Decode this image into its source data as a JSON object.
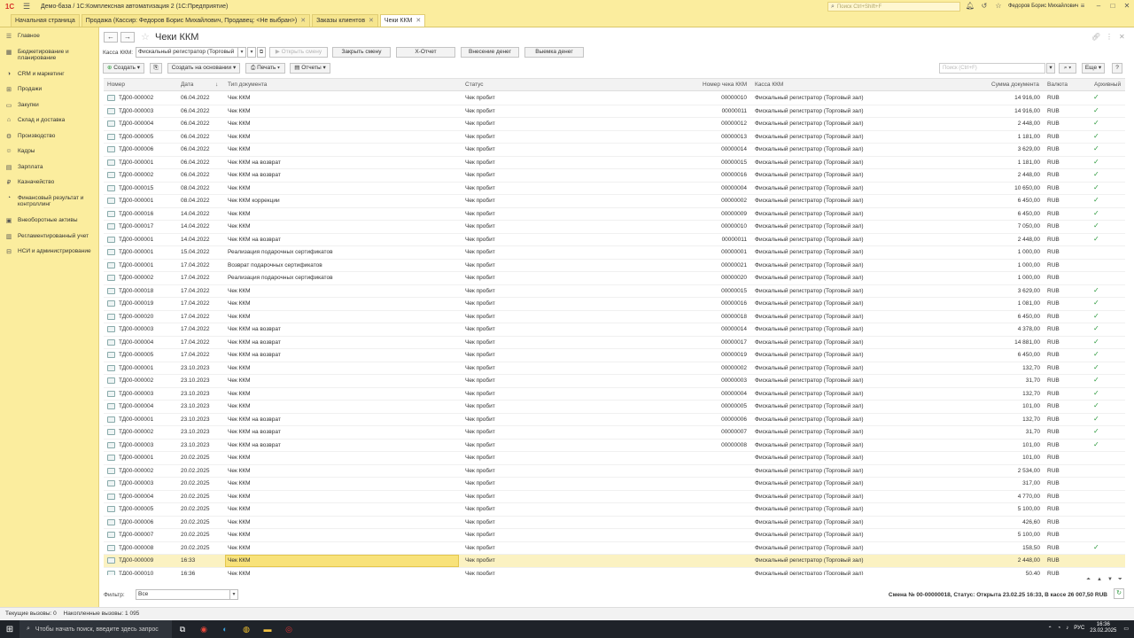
{
  "app": {
    "logo": "1С",
    "title": "Демо-база / 1С:Комплексная автоматизация 2  (1С:Предприятие)",
    "search_placeholder": "Поиск Ctrl+Shift+F",
    "user": "Федоров Борис Михайлович"
  },
  "tabs": [
    {
      "label": "Начальная страница",
      "closable": false,
      "active": false
    },
    {
      "label": "Продажа (Кассир: Федоров Борис Михайлович, Продавец: <Не выбран>)",
      "closable": true,
      "active": false
    },
    {
      "label": "Заказы клиентов",
      "closable": true,
      "active": false
    },
    {
      "label": "Чеки ККМ",
      "closable": true,
      "active": true
    }
  ],
  "sidebar": {
    "items": [
      {
        "icon": "menu-icon",
        "label": "Главное"
      },
      {
        "icon": "budget-icon",
        "label": "Бюджетирование и планирование"
      },
      {
        "icon": "crm-icon",
        "label": "CRM и маркетинг"
      },
      {
        "icon": "sales-icon",
        "label": "Продажи"
      },
      {
        "icon": "purchase-icon",
        "label": "Закупки"
      },
      {
        "icon": "warehouse-icon",
        "label": "Склад и доставка"
      },
      {
        "icon": "production-icon",
        "label": "Производство"
      },
      {
        "icon": "staff-icon",
        "label": "Кадры"
      },
      {
        "icon": "salary-icon",
        "label": "Зарплата"
      },
      {
        "icon": "treasury-icon",
        "label": "Казначейство"
      },
      {
        "icon": "finance-icon",
        "label": "Финансовый результат и контроллинг"
      },
      {
        "icon": "assets-icon",
        "label": "Внеоборотные активы"
      },
      {
        "icon": "report-icon",
        "label": "Регламентированный учет"
      },
      {
        "icon": "nsi-icon",
        "label": "НСИ и администрирование"
      }
    ]
  },
  "page": {
    "title": "Чеки ККМ",
    "kkm_label": "Касса ККМ:",
    "kkm_value": "Фискальный регистратор (Торговый",
    "buttons": {
      "open_shift": "Открыть смену",
      "close_shift": "Закрыть смену",
      "x_report": "Х-Отчет",
      "cash_in": "Внесение денег",
      "cash_out": "Выемка денег"
    },
    "toolbar": {
      "create": "Создать",
      "create_based": "Создать на основании",
      "print": "Печать",
      "reports": "Отчеты",
      "search_placeholder": "Поиск (Ctrl+F)",
      "more": "Еще",
      "help": "?"
    }
  },
  "table": {
    "columns": [
      "Номер",
      "Дата",
      "Тип документа",
      "Статус",
      "Номер чека ККМ",
      "Касса ККМ",
      "Сумма документа",
      "Валюта",
      "Архивный"
    ],
    "rows": [
      {
        "num": "ТД00-000002",
        "date": "06.04.2022",
        "type": "Чек ККМ",
        "status": "Чек пробит",
        "check": "00000010",
        "kkm": "Фискальный регистратор (Торговый зал)",
        "sum": "14 916,00",
        "cur": "RUB",
        "arch": true
      },
      {
        "num": "ТД00-000003",
        "date": "06.04.2022",
        "type": "Чек ККМ",
        "status": "Чек пробит",
        "check": "00000011",
        "kkm": "Фискальный регистратор (Торговый зал)",
        "sum": "14 916,00",
        "cur": "RUB",
        "arch": true
      },
      {
        "num": "ТД00-000004",
        "date": "06.04.2022",
        "type": "Чек ККМ",
        "status": "Чек пробит",
        "check": "00000012",
        "kkm": "Фискальный регистратор (Торговый зал)",
        "sum": "2 448,00",
        "cur": "RUB",
        "arch": true
      },
      {
        "num": "ТД00-000005",
        "date": "06.04.2022",
        "type": "Чек ККМ",
        "status": "Чек пробит",
        "check": "00000013",
        "kkm": "Фискальный регистратор (Торговый зал)",
        "sum": "1 181,00",
        "cur": "RUB",
        "arch": true
      },
      {
        "num": "ТД00-000006",
        "date": "06.04.2022",
        "type": "Чек ККМ",
        "status": "Чек пробит",
        "check": "00000014",
        "kkm": "Фискальный регистратор (Торговый зал)",
        "sum": "3 629,00",
        "cur": "RUB",
        "arch": true
      },
      {
        "num": "ТД00-000001",
        "date": "06.04.2022",
        "type": "Чек ККМ на возврат",
        "status": "Чек пробит",
        "check": "00000015",
        "kkm": "Фискальный регистратор (Торговый зал)",
        "sum": "1 181,00",
        "cur": "RUB",
        "arch": true
      },
      {
        "num": "ТД00-000002",
        "date": "06.04.2022",
        "type": "Чек ККМ на возврат",
        "status": "Чек пробит",
        "check": "00000016",
        "kkm": "Фискальный регистратор (Торговый зал)",
        "sum": "2 448,00",
        "cur": "RUB",
        "arch": true
      },
      {
        "num": "ТД00-000015",
        "date": "08.04.2022",
        "type": "Чек ККМ",
        "status": "Чек пробит",
        "check": "00000004",
        "kkm": "Фискальный регистратор (Торговый зал)",
        "sum": "10 650,00",
        "cur": "RUB",
        "arch": true
      },
      {
        "num": "ТД00-000001",
        "date": "08.04.2022",
        "type": "Чек ККМ коррекции",
        "status": "Чек пробит",
        "check": "00000002",
        "kkm": "Фискальный регистратор (Торговый зал)",
        "sum": "6 450,00",
        "cur": "RUB",
        "arch": true
      },
      {
        "num": "ТД00-000016",
        "date": "14.04.2022",
        "type": "Чек ККМ",
        "status": "Чек пробит",
        "check": "00000009",
        "kkm": "Фискальный регистратор (Торговый зал)",
        "sum": "6 450,00",
        "cur": "RUB",
        "arch": true
      },
      {
        "num": "ТД00-000017",
        "date": "14.04.2022",
        "type": "Чек ККМ",
        "status": "Чек пробит",
        "check": "00000010",
        "kkm": "Фискальный регистратор (Торговый зал)",
        "sum": "7 050,00",
        "cur": "RUB",
        "arch": true
      },
      {
        "num": "ТД00-000001",
        "date": "14.04.2022",
        "type": "Чек ККМ на возврат",
        "status": "Чек пробит",
        "check": "00000011",
        "kkm": "Фискальный регистратор (Торговый зал)",
        "sum": "2 448,00",
        "cur": "RUB",
        "arch": true
      },
      {
        "num": "ТД00-000001",
        "date": "15.04.2022",
        "type": "Реализация подарочных сертификатов",
        "status": "Чек пробит",
        "check": "00000001",
        "kkm": "Фискальный регистратор (Торговый зал)",
        "sum": "1 000,00",
        "cur": "RUB",
        "arch": false
      },
      {
        "num": "ТД00-000001",
        "date": "17.04.2022",
        "type": "Возврат подарочных сертификатов",
        "status": "Чек пробит",
        "check": "00000021",
        "kkm": "Фискальный регистратор (Торговый зал)",
        "sum": "1 000,00",
        "cur": "RUB",
        "arch": false
      },
      {
        "num": "ТД00-000002",
        "date": "17.04.2022",
        "type": "Реализация подарочных сертификатов",
        "status": "Чек пробит",
        "check": "00000020",
        "kkm": "Фискальный регистратор (Торговый зал)",
        "sum": "1 000,00",
        "cur": "RUB",
        "arch": false
      },
      {
        "num": "ТД00-000018",
        "date": "17.04.2022",
        "type": "Чек ККМ",
        "status": "Чек пробит",
        "check": "00000015",
        "kkm": "Фискальный регистратор (Торговый зал)",
        "sum": "3 629,00",
        "cur": "RUB",
        "arch": true
      },
      {
        "num": "ТД00-000019",
        "date": "17.04.2022",
        "type": "Чек ККМ",
        "status": "Чек пробит",
        "check": "00000016",
        "kkm": "Фискальный регистратор (Торговый зал)",
        "sum": "1 081,00",
        "cur": "RUB",
        "arch": true
      },
      {
        "num": "ТД00-000020",
        "date": "17.04.2022",
        "type": "Чек ККМ",
        "status": "Чек пробит",
        "check": "00000018",
        "kkm": "Фискальный регистратор (Торговый зал)",
        "sum": "6 450,00",
        "cur": "RUB",
        "arch": true
      },
      {
        "num": "ТД00-000003",
        "date": "17.04.2022",
        "type": "Чек ККМ на возврат",
        "status": "Чек пробит",
        "check": "00000014",
        "kkm": "Фискальный регистратор (Торговый зал)",
        "sum": "4 378,00",
        "cur": "RUB",
        "arch": true
      },
      {
        "num": "ТД00-000004",
        "date": "17.04.2022",
        "type": "Чек ККМ на возврат",
        "status": "Чек пробит",
        "check": "00000017",
        "kkm": "Фискальный регистратор (Торговый зал)",
        "sum": "14 881,00",
        "cur": "RUB",
        "arch": true
      },
      {
        "num": "ТД00-000005",
        "date": "17.04.2022",
        "type": "Чек ККМ на возврат",
        "status": "Чек пробит",
        "check": "00000019",
        "kkm": "Фискальный регистратор (Торговый зал)",
        "sum": "6 450,00",
        "cur": "RUB",
        "arch": true
      },
      {
        "num": "ТД00-000001",
        "date": "23.10.2023",
        "type": "Чек ККМ",
        "status": "Чек пробит",
        "check": "00000002",
        "kkm": "Фискальный регистратор (Торговый зал)",
        "sum": "132,70",
        "cur": "RUB",
        "arch": true
      },
      {
        "num": "ТД00-000002",
        "date": "23.10.2023",
        "type": "Чек ККМ",
        "status": "Чек пробит",
        "check": "00000003",
        "kkm": "Фискальный регистратор (Торговый зал)",
        "sum": "31,70",
        "cur": "RUB",
        "arch": true
      },
      {
        "num": "ТД00-000003",
        "date": "23.10.2023",
        "type": "Чек ККМ",
        "status": "Чек пробит",
        "check": "00000004",
        "kkm": "Фискальный регистратор (Торговый зал)",
        "sum": "132,70",
        "cur": "RUB",
        "arch": true
      },
      {
        "num": "ТД00-000004",
        "date": "23.10.2023",
        "type": "Чек ККМ",
        "status": "Чек пробит",
        "check": "00000005",
        "kkm": "Фискальный регистратор (Торговый зал)",
        "sum": "101,00",
        "cur": "RUB",
        "arch": true
      },
      {
        "num": "ТД00-000001",
        "date": "23.10.2023",
        "type": "Чек ККМ на возврат",
        "status": "Чек пробит",
        "check": "00000006",
        "kkm": "Фискальный регистратор (Торговый зал)",
        "sum": "132,70",
        "cur": "RUB",
        "arch": true
      },
      {
        "num": "ТД00-000002",
        "date": "23.10.2023",
        "type": "Чек ККМ на возврат",
        "status": "Чек пробит",
        "check": "00000007",
        "kkm": "Фискальный регистратор (Торговый зал)",
        "sum": "31,70",
        "cur": "RUB",
        "arch": true
      },
      {
        "num": "ТД00-000003",
        "date": "23.10.2023",
        "type": "Чек ККМ на возврат",
        "status": "Чек пробит",
        "check": "00000008",
        "kkm": "Фискальный регистратор (Торговый зал)",
        "sum": "101,00",
        "cur": "RUB",
        "arch": true
      },
      {
        "num": "ТД00-000001",
        "date": "20.02.2025",
        "type": "Чек ККМ",
        "status": "Чек пробит",
        "check": "",
        "kkm": "Фискальный регистратор (Торговый зал)",
        "sum": "101,00",
        "cur": "RUB",
        "arch": false
      },
      {
        "num": "ТД00-000002",
        "date": "20.02.2025",
        "type": "Чек ККМ",
        "status": "Чек пробит",
        "check": "",
        "kkm": "Фискальный регистратор (Торговый зал)",
        "sum": "2 534,00",
        "cur": "RUB",
        "arch": false
      },
      {
        "num": "ТД00-000003",
        "date": "20.02.2025",
        "type": "Чек ККМ",
        "status": "Чек пробит",
        "check": "",
        "kkm": "Фискальный регистратор (Торговый зал)",
        "sum": "317,00",
        "cur": "RUB",
        "arch": false
      },
      {
        "num": "ТД00-000004",
        "date": "20.02.2025",
        "type": "Чек ККМ",
        "status": "Чек пробит",
        "check": "",
        "kkm": "Фискальный регистратор (Торговый зал)",
        "sum": "4 770,00",
        "cur": "RUB",
        "arch": false
      },
      {
        "num": "ТД00-000005",
        "date": "20.02.2025",
        "type": "Чек ККМ",
        "status": "Чек пробит",
        "check": "",
        "kkm": "Фискальный регистратор (Торговый зал)",
        "sum": "5 100,00",
        "cur": "RUB",
        "arch": false
      },
      {
        "num": "ТД00-000006",
        "date": "20.02.2025",
        "type": "Чек ККМ",
        "status": "Чек пробит",
        "check": "",
        "kkm": "Фискальный регистратор (Торговый зал)",
        "sum": "426,60",
        "cur": "RUB",
        "arch": false
      },
      {
        "num": "ТД00-000007",
        "date": "20.02.2025",
        "type": "Чек ККМ",
        "status": "Чек пробит",
        "check": "",
        "kkm": "Фискальный регистратор (Торговый зал)",
        "sum": "5 100,00",
        "cur": "RUB",
        "arch": false
      },
      {
        "num": "ТД00-000008",
        "date": "20.02.2025",
        "type": "Чек ККМ",
        "status": "Чек пробит",
        "check": "",
        "kkm": "Фискальный регистратор (Торговый зал)",
        "sum": "158,50",
        "cur": "RUB",
        "arch": true
      },
      {
        "num": "ТД00-000009",
        "date": "16:33",
        "type": "Чек ККМ",
        "status": "Чек пробит",
        "check": "",
        "kkm": "Фискальный регистратор (Торговый зал)",
        "sum": "2 448,00",
        "cur": "RUB",
        "arch": false,
        "selected": true
      },
      {
        "num": "ТД00-000010",
        "date": "16:36",
        "type": "Чек ККМ",
        "status": "Чек пробит",
        "check": "",
        "kkm": "Фискальный регистратор (Торговый зал)",
        "sum": "50,40",
        "cur": "RUB",
        "arch": false
      }
    ]
  },
  "footer": {
    "filter_label": "Фильтр:",
    "filter_value": "Все",
    "shift_status": "Смена № 00-00000018, Статус: Открыта 23.02.25 16:33, В кассе 26 007,50 RUB"
  },
  "statusbar": {
    "current_calls": "Текущие вызовы: 0",
    "accum_calls": "Накопленные вызовы: 1 095"
  },
  "taskbar": {
    "search_placeholder": "Чтобы начать поиск, введите здесь запрос",
    "lang": "РУС",
    "time": "16:36",
    "date": "23.02.2025"
  },
  "colors": {
    "sidebar_bg": "#fbed9e",
    "selected_row": "#fbf2c2",
    "check_green": "#2e9a3e"
  }
}
